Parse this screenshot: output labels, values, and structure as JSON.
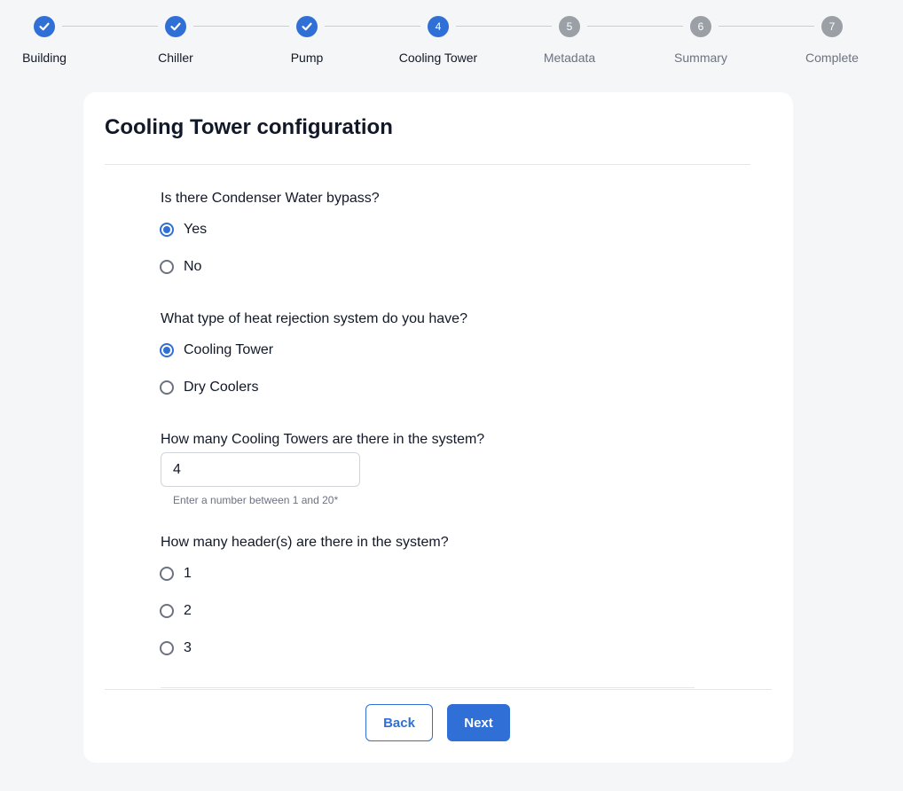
{
  "stepper": {
    "steps": [
      {
        "number": "1",
        "label": "Building",
        "state": "done"
      },
      {
        "number": "2",
        "label": "Chiller",
        "state": "done"
      },
      {
        "number": "3",
        "label": "Pump",
        "state": "done"
      },
      {
        "number": "4",
        "label": "Cooling Tower",
        "state": "active"
      },
      {
        "number": "5",
        "label": "Metadata",
        "state": "todo"
      },
      {
        "number": "6",
        "label": "Summary",
        "state": "todo"
      },
      {
        "number": "7",
        "label": "Complete",
        "state": "todo"
      }
    ]
  },
  "colors": {
    "accent": "#2f6fd6",
    "inactive": "#9aa0a6",
    "background": "#f5f6f8"
  },
  "form": {
    "title": "Cooling Tower configuration",
    "bypass": {
      "question": "Is there Condenser Water bypass?",
      "options": [
        "Yes",
        "No"
      ],
      "selected": "Yes"
    },
    "heat_rejection": {
      "question": "What type of heat rejection system do you have?",
      "options": [
        "Cooling Tower",
        "Dry Coolers"
      ],
      "selected": "Cooling Tower"
    },
    "tower_count": {
      "question": "How many Cooling Towers are there in the system?",
      "value": "4",
      "hint": "Enter a number between 1 and 20*"
    },
    "headers": {
      "question": "How many header(s) are there in the system?",
      "options": [
        "1",
        "2",
        "3"
      ],
      "selected": null
    }
  },
  "buttons": {
    "back": "Back",
    "next": "Next"
  }
}
